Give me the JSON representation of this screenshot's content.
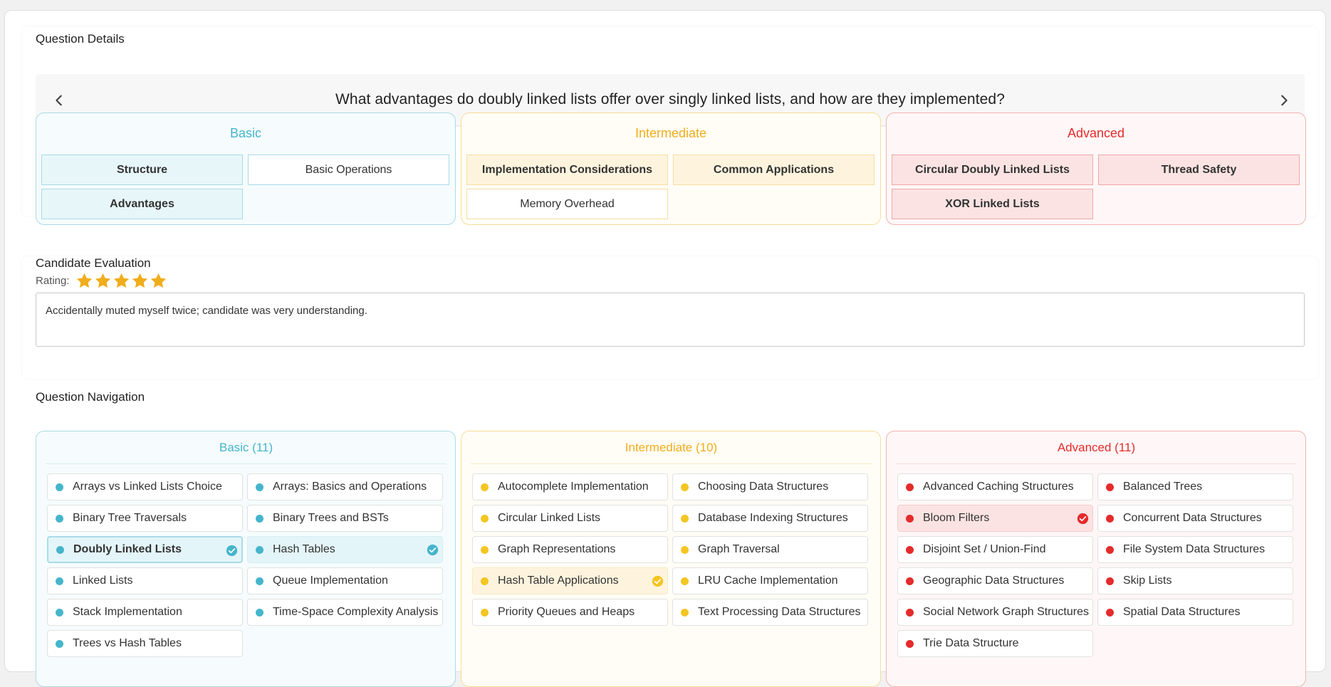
{
  "question_details": {
    "title": "Question Details",
    "question": "What advantages do doubly linked lists offer over singly linked lists, and how are they implemented?",
    "prev_icon": "chevron-left-icon",
    "next_icon": "chevron-right-icon",
    "tiers": {
      "basic": {
        "title": "Basic",
        "topics": [
          {
            "label": "Structure",
            "covered": true
          },
          {
            "label": "Basic Operations",
            "covered": false
          },
          {
            "label": "Advantages",
            "covered": true
          }
        ]
      },
      "intermediate": {
        "title": "Intermediate",
        "topics": [
          {
            "label": "Implementation Considerations",
            "covered": true
          },
          {
            "label": "Common Applications",
            "covered": true
          },
          {
            "label": "Memory Overhead",
            "covered": false
          }
        ]
      },
      "advanced": {
        "title": "Advanced",
        "topics": [
          {
            "label": "Circular Doubly Linked Lists",
            "covered": true
          },
          {
            "label": "Thread Safety",
            "covered": true
          },
          {
            "label": "XOR Linked Lists",
            "covered": true
          }
        ]
      }
    }
  },
  "evaluation": {
    "title": "Candidate Evaluation",
    "rating_label": "Rating:",
    "rating": 5,
    "rating_max": 5,
    "notes": "Accidentally muted myself twice; candidate was very understanding."
  },
  "navigation": {
    "title": "Question Navigation",
    "basic": {
      "title": "Basic (11)",
      "items": [
        {
          "label": "Arrays vs Linked Lists Choice",
          "completed": false
        },
        {
          "label": "Arrays: Basics and Operations",
          "completed": false
        },
        {
          "label": "Binary Tree Traversals",
          "completed": false
        },
        {
          "label": "Binary Trees and BSTs",
          "completed": false
        },
        {
          "label": "Doubly Linked Lists",
          "completed": true,
          "current": true
        },
        {
          "label": "Hash Tables",
          "completed": true
        },
        {
          "label": "Linked Lists",
          "completed": false
        },
        {
          "label": "Queue Implementation",
          "completed": false
        },
        {
          "label": "Stack Implementation",
          "completed": false
        },
        {
          "label": "Time-Space Complexity Analysis",
          "completed": false
        },
        {
          "label": "Trees vs Hash Tables",
          "completed": false
        }
      ]
    },
    "intermediate": {
      "title": "Intermediate (10)",
      "items": [
        {
          "label": "Autocomplete Implementation",
          "completed": false
        },
        {
          "label": "Choosing Data Structures",
          "completed": false
        },
        {
          "label": "Circular Linked Lists",
          "completed": false
        },
        {
          "label": "Database Indexing Structures",
          "completed": false
        },
        {
          "label": "Graph Representations",
          "completed": false
        },
        {
          "label": "Graph Traversal",
          "completed": false
        },
        {
          "label": "Hash Table Applications",
          "completed": true
        },
        {
          "label": "LRU Cache Implementation",
          "completed": false
        },
        {
          "label": "Priority Queues and Heaps",
          "completed": false
        },
        {
          "label": "Text Processing Data Structures",
          "completed": false
        }
      ]
    },
    "advanced": {
      "title": "Advanced (11)",
      "items": [
        {
          "label": "Advanced Caching Structures",
          "completed": false
        },
        {
          "label": "Balanced Trees",
          "completed": false
        },
        {
          "label": "Bloom Filters",
          "completed": true
        },
        {
          "label": "Concurrent Data Structures",
          "completed": false
        },
        {
          "label": "Disjoint Set / Union-Find",
          "completed": false
        },
        {
          "label": "File System Data Structures",
          "completed": false
        },
        {
          "label": "Geographic Data Structures",
          "completed": false
        },
        {
          "label": "Skip Lists",
          "completed": false
        },
        {
          "label": "Social Network Graph Structures",
          "completed": false
        },
        {
          "label": "Spatial Data Structures",
          "completed": false
        },
        {
          "label": "Trie Data Structure",
          "completed": false
        }
      ]
    }
  },
  "colors": {
    "basic": "#46b5cc",
    "intermediate": "#f0ad1c",
    "advanced": "#e52b2b",
    "star": "#f0ad1c"
  }
}
